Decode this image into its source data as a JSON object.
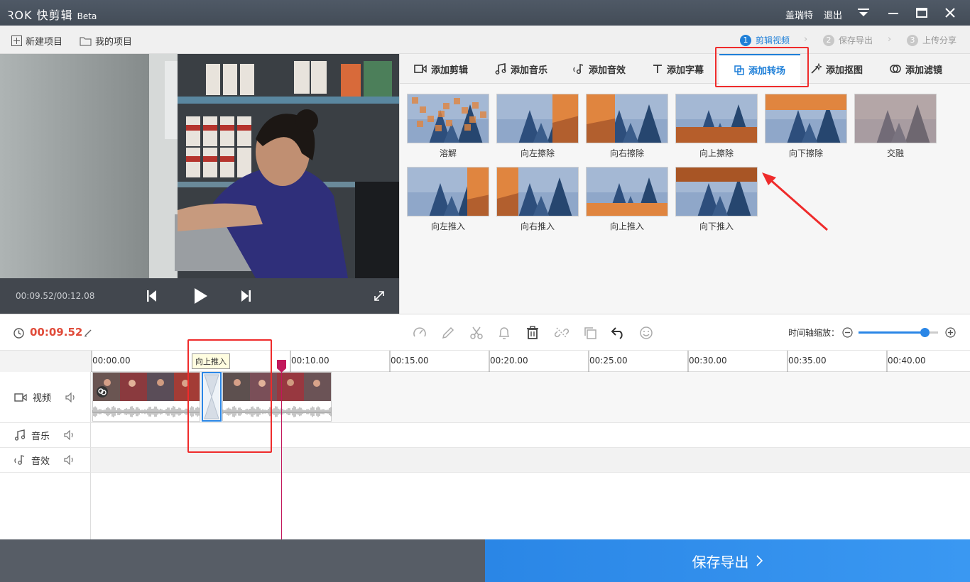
{
  "app": {
    "title": "快剪辑",
    "edition": "Beta",
    "user": "盖瑞特",
    "logout": "退出"
  },
  "menu": {
    "new_project": "新建项目",
    "my_projects": "我的项目"
  },
  "steps": [
    {
      "num": "1",
      "label": "剪辑视频"
    },
    {
      "num": "2",
      "label": "保存导出"
    },
    {
      "num": "3",
      "label": "上传分享"
    }
  ],
  "player": {
    "time": "00:09.52/00:12.08"
  },
  "tabs": [
    "添加剪辑",
    "添加音乐",
    "添加音效",
    "添加字幕",
    "添加转场",
    "添加抠图",
    "添加滤镜"
  ],
  "active_tab": "添加转场",
  "transitions": [
    "溶解",
    "向左擦除",
    "向右擦除",
    "向上擦除",
    "向下擦除",
    "交融",
    "向左推入",
    "向右推入",
    "向上推入",
    "向下推入"
  ],
  "toolbar": {
    "current_time": "00:09.52",
    "zoom_label": "时间轴缩放：",
    "zoom_value": 0.83
  },
  "ruler": [
    "00:00.00",
    "00:10.00",
    "00:15.00",
    "00:20.00",
    "00:25.00",
    "00:30.00",
    "00:35.00",
    "00:40.00"
  ],
  "tooltip": "向上推入",
  "tracks": {
    "video": "视频",
    "music": "音乐",
    "sfx": "音效"
  },
  "footer": {
    "export": "保存导出"
  },
  "colors": {
    "accent": "#1e7fd8",
    "highlight": "#ef2b2b",
    "export_bg": "#2a86e6"
  }
}
